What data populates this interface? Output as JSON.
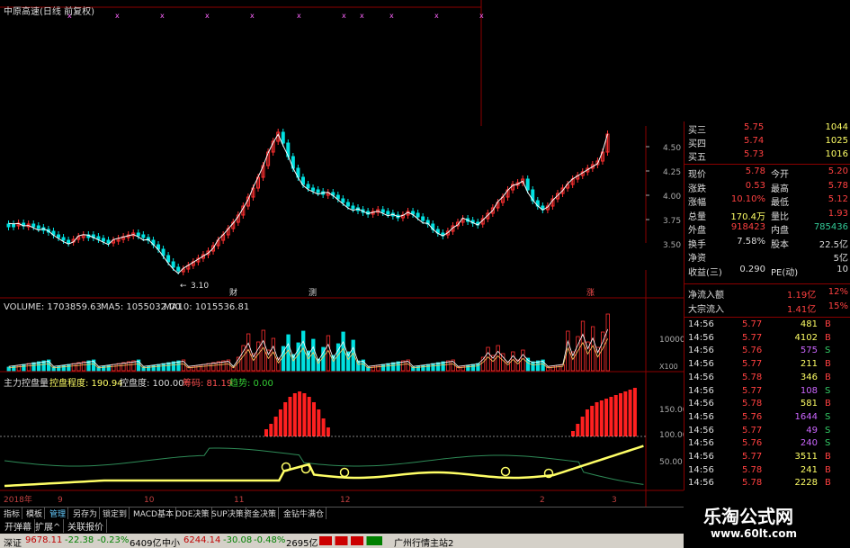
{
  "title": "中原高速(日线 前复权)",
  "price_axis": [
    "4.50",
    "4.25",
    "4.00",
    "3.75",
    "3.50"
  ],
  "volume_axis": [
    "10000",
    "X100"
  ],
  "indicator_axis": [
    "150.00",
    "100.00",
    "50.00"
  ],
  "low_marker": "3.10",
  "candle_markers": [
    "财",
    "测",
    "涨"
  ],
  "volume_legend": {
    "vol": "VOLUME: 1703859.63",
    "ma5": "MA5: 1055032.00",
    "ma10": "MA10: 1015536.81"
  },
  "indicator_legend": {
    "name": "主力控盘量",
    "degree_label": "控盘程度: 190.94",
    "ctrl_label": "控盘度: 100.00",
    "rise_label": "筹码: 81.19",
    "fall_label": "趋势: 0.00"
  },
  "date_axis": [
    "2018年",
    "9",
    "10",
    "11",
    "12",
    "2",
    "3"
  ],
  "order_book": [
    {
      "label": "买三",
      "price": "5.75",
      "vol": "1044"
    },
    {
      "label": "买四",
      "price": "5.74",
      "vol": "1025"
    },
    {
      "label": "买五",
      "price": "5.73",
      "vol": "1016"
    }
  ],
  "stats": [
    {
      "l1": "现价",
      "v1": "5.78",
      "l2": "今开",
      "v2": "5.20"
    },
    {
      "l1": "涨跌",
      "v1": "0.53",
      "l2": "最高",
      "v2": "5.78"
    },
    {
      "l1": "涨幅",
      "v1": "10.10%",
      "l2": "最低",
      "v2": "5.12"
    },
    {
      "l1": "总量",
      "v1": "170.4万",
      "l2": "量比",
      "v2": "1.93"
    },
    {
      "l1": "外盘",
      "v1": "918423",
      "l2": "内盘",
      "v2": "785436"
    },
    {
      "l1": "换手",
      "v1": "7.58%",
      "l2": "股本",
      "v2": "22.5亿"
    },
    {
      "l1": "净资",
      "v1": "",
      "l2": "",
      "v2": "5亿"
    },
    {
      "l1": "收益(三)",
      "v1": "0.290",
      "l2": "PE(动)",
      "v2": "10"
    }
  ],
  "flows": [
    {
      "label": "净流入额",
      "value": "1.19亿",
      "pct": "12%"
    },
    {
      "label": "大宗流入",
      "value": "1.41亿",
      "pct": "15%"
    }
  ],
  "trades": [
    {
      "time": "14:56",
      "price": "5.77",
      "vol": "481",
      "side": "B"
    },
    {
      "time": "14:56",
      "price": "5.77",
      "vol": "4102",
      "side": "B"
    },
    {
      "time": "14:56",
      "price": "5.76",
      "vol": "575",
      "side": "S"
    },
    {
      "time": "14:56",
      "price": "5.77",
      "vol": "211",
      "side": "B"
    },
    {
      "time": "14:56",
      "price": "5.78",
      "vol": "346",
      "side": "B"
    },
    {
      "time": "14:56",
      "price": "5.77",
      "vol": "108",
      "side": "S"
    },
    {
      "time": "14:56",
      "price": "5.78",
      "vol": "581",
      "side": "B"
    },
    {
      "time": "14:56",
      "price": "5.76",
      "vol": "1644",
      "side": "S"
    },
    {
      "time": "14:56",
      "price": "5.77",
      "vol": "49",
      "side": "S"
    },
    {
      "time": "14:56",
      "price": "5.76",
      "vol": "240",
      "side": "S"
    },
    {
      "time": "14:56",
      "price": "5.77",
      "vol": "3511",
      "side": "B"
    },
    {
      "time": "14:56",
      "price": "5.78",
      "vol": "241",
      "side": "B"
    },
    {
      "time": "14:56",
      "price": "5.78",
      "vol": "2228",
      "side": "B"
    }
  ],
  "tabs": [
    "指标",
    "模板",
    "管理",
    "另存为",
    "锁定到",
    "MACD基本",
    "DDE决策",
    "SUP决策",
    "资金决策",
    "金钻牛满仓"
  ],
  "tabs2": [
    "开弹幕",
    "扩展^",
    "关联报价"
  ],
  "status": {
    "sh_name": "深证",
    "sh_val": "9678.11",
    "sh_chg": "-22.38",
    "sh_pct": "-0.23%",
    "sh_amt": "6409亿",
    "sz_name": "中小",
    "sz_val": "6244.14",
    "sz_chg": "-30.08",
    "sz_pct": "-0.48%",
    "sz_amt": "2695亿",
    "server": "广州行情主站2"
  },
  "watermark": {
    "line1": "乐淘公式网",
    "line2": "www.60lt.com"
  },
  "colors": {
    "up": "#ff3030",
    "down": "#00e0e0",
    "accent_yellow": "#ffff00",
    "ma_line": "#ffffff"
  }
}
